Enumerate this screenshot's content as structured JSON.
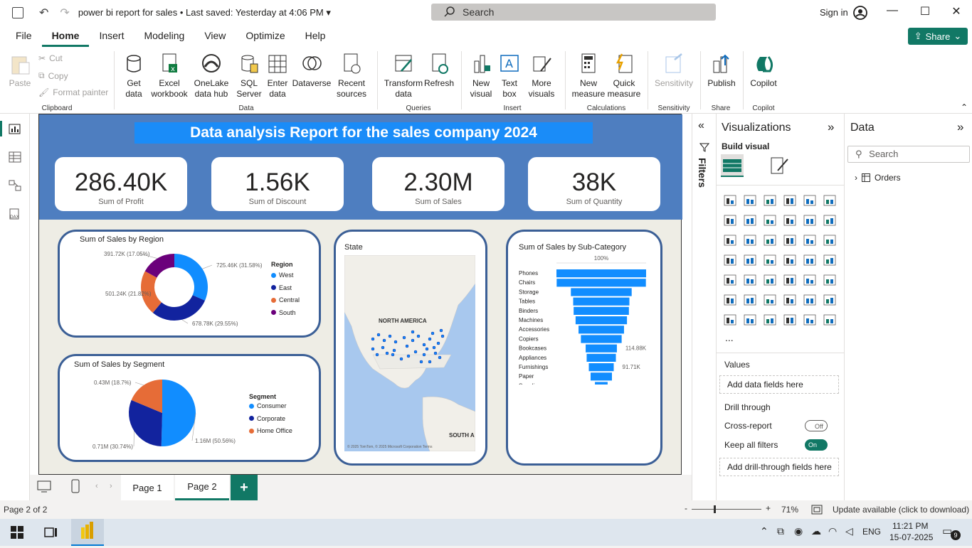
{
  "titlebar": {
    "doc_title": "power bi report for sales",
    "saved_status": " • Last saved: Yesterday at 4:06 PM",
    "search_placeholder": "Search",
    "signin": "Sign in"
  },
  "menu": [
    "File",
    "Home",
    "Insert",
    "Modeling",
    "View",
    "Optimize",
    "Help"
  ],
  "share_label": "Share",
  "ribbon": {
    "clipboard": {
      "paste": "Paste",
      "cut": "Cut",
      "copy": "Copy",
      "format_painter": "Format painter",
      "group": "Clipboard"
    },
    "data": {
      "get_data": "Get data",
      "excel": "Excel workbook",
      "onelake": "OneLake data hub",
      "sql": "SQL Server",
      "enter": "Enter data",
      "dataverse": "Dataverse",
      "recent": "Recent sources",
      "group": "Data"
    },
    "queries": {
      "transform": "Transform data",
      "refresh": "Refresh",
      "group": "Queries"
    },
    "insert": {
      "new_visual": "New visual",
      "text_box": "Text box",
      "more_visuals": "More visuals",
      "group": "Insert"
    },
    "calculations": {
      "new_measure": "New measure",
      "quick_measure": "Quick measure",
      "group": "Calculations"
    },
    "sensitivity": {
      "label": "Sensitivity",
      "group": "Sensitivity"
    },
    "share": {
      "publish": "Publish",
      "group": "Share"
    },
    "copilot": {
      "label": "Copilot",
      "group": "Copilot"
    }
  },
  "report": {
    "title": "Data analysis Report for the sales company 2024",
    "kpis": [
      {
        "value": "286.40K",
        "label": "Sum of Profit"
      },
      {
        "value": "1.56K",
        "label": "Sum of Discount"
      },
      {
        "value": "2.30M",
        "label": "Sum of Sales"
      },
      {
        "value": "38K",
        "label": "Sum of Quantity"
      }
    ],
    "map_title": "State",
    "map_labels": {
      "north_america": "NORTH AMERICA",
      "south_america": "SOUTH A",
      "attribution": "© 2025 TomTom, © 2025 Microsoft Corporation  Terms"
    }
  },
  "chart_data": [
    {
      "type": "pie",
      "variant": "donut",
      "title": "Sum of Sales by Region",
      "legend_title": "Region",
      "legend_position": "right",
      "categories": [
        "West",
        "East",
        "Central",
        "South"
      ],
      "values": [
        725.46,
        678.78,
        501.24,
        391.72
      ],
      "labels": [
        "725.46K (31.58%)",
        "678.78K (29.55%)",
        "501.24K (21.82%)",
        "391.72K (17.05%)"
      ],
      "colors": [
        "#118dff",
        "#12239e",
        "#e66c37",
        "#6b007b"
      ]
    },
    {
      "type": "pie",
      "title": "Sum of Sales by Segment",
      "legend_title": "Segment",
      "legend_position": "right",
      "categories": [
        "Consumer",
        "Corporate",
        "Home Office"
      ],
      "values": [
        1.16,
        0.71,
        0.43
      ],
      "labels": [
        "1.16M (50.56%)",
        "0.71M (30.74%)",
        "0.43M (18.7%)"
      ],
      "colors": [
        "#118dff",
        "#12239e",
        "#e66c37"
      ]
    },
    {
      "type": "bar",
      "variant": "funnel",
      "title": "Sum of Sales by Sub-Category",
      "top_label": "100%",
      "categories": [
        "Phones",
        "Chairs",
        "Storage",
        "Tables",
        "Binders",
        "Machines",
        "Accessories",
        "Copiers",
        "Bookcases",
        "Appliances",
        "Furnishings",
        "Paper",
        "Supplies"
      ],
      "values": [
        330.0,
        328.4,
        223.8,
        206.9,
        203.4,
        189.2,
        167.4,
        150.0,
        114.88,
        107.5,
        91.71,
        78.5,
        46.7
      ],
      "data_labels": {
        "8": "114.88K",
        "10": "91.71K"
      },
      "color": "#118dff"
    }
  ],
  "bottom": {
    "pages": [
      "Page 1",
      "Page 2"
    ],
    "add": "+"
  },
  "status": {
    "page_info": "Page 2 of 2",
    "zoom": "71%",
    "update": "Update available (click to download)",
    "minus": "-",
    "plus": "+"
  },
  "filters_label": "Filters",
  "viz": {
    "title": "Visualizations",
    "build": "Build visual",
    "values_label": "Values",
    "add_fields": "Add data fields here",
    "drill": "Drill through",
    "cross_report": "Cross-report",
    "keep_filters": "Keep all filters",
    "off": "Off",
    "on": "On",
    "add_drill": "Add drill-through fields here",
    "more": "..."
  },
  "data_pane": {
    "title": "Data",
    "search": "Search",
    "table": "Orders"
  },
  "taskbar": {
    "time": "11:21 PM",
    "date": "15-07-2025",
    "lang": "ENG",
    "badge": "9"
  }
}
